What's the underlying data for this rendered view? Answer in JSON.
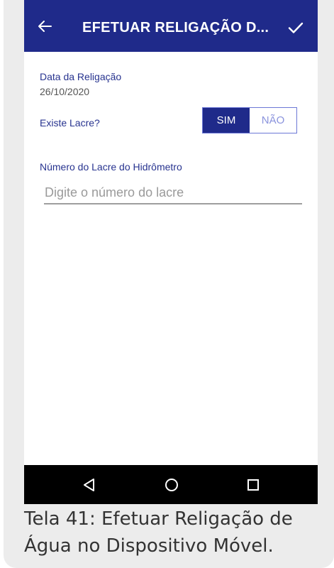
{
  "appbar": {
    "title": "EFETUAR RELIGAÇÃO D...",
    "back_icon": "arrow-left-icon",
    "confirm_icon": "check-icon",
    "color": "#1f2a8a"
  },
  "form": {
    "date_label": "Data da Religação",
    "date_value": "26/10/2020",
    "seal_question": "Existe Lacre?",
    "seal_options": [
      "SIM",
      "NÃO"
    ],
    "seal_selected": "SIM",
    "seal_number_label": "Número do Lacre do Hidrômetro",
    "seal_number_value": "",
    "seal_number_placeholder": "Digite o número do lacre"
  },
  "navbar": {
    "icons": [
      "back-triangle-icon",
      "home-circle-icon",
      "recents-square-icon"
    ]
  },
  "caption": {
    "text": "Tela 41: Efetuar Religação de Água no Dispositivo Móvel."
  }
}
